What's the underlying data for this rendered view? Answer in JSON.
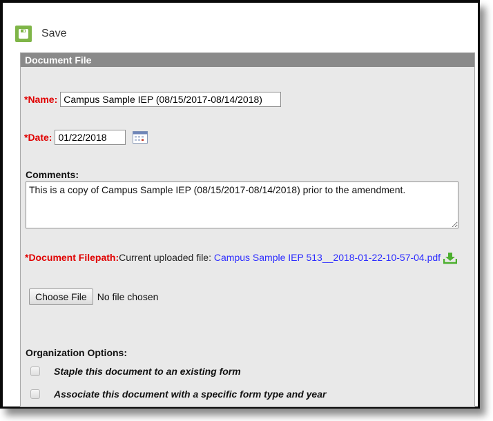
{
  "toolbar": {
    "save_label": "Save",
    "save_icon": "save-icon"
  },
  "panel": {
    "title": "Document File"
  },
  "form": {
    "name_label": "*Name:",
    "name_value": "Campus Sample IEP (08/15/2017-08/14/2018)",
    "date_label": "*Date:",
    "date_value": "01/22/2018",
    "comments_label": "Comments:",
    "comments_value": "This is a copy of Campus Sample IEP (08/15/2017-08/14/2018) prior to the amendment.",
    "filepath_label": "*Document Filepath:",
    "current_file_prefix": "Current uploaded file: ",
    "current_file_name": "Campus Sample IEP 513__2018-01-22-10-57-04.pdf",
    "choose_file_label": "Choose File",
    "no_file_text": "No file chosen",
    "org_label": "Organization Options:",
    "options": [
      {
        "label": "Staple this document to an existing form",
        "checked": false
      },
      {
        "label": "Associate this document with a specific form type and year",
        "checked": false
      }
    ]
  },
  "colors": {
    "required": "#e00000",
    "link": "#2d2dff",
    "header_bg": "#8a8a8a",
    "save_green": "#7fb548"
  }
}
